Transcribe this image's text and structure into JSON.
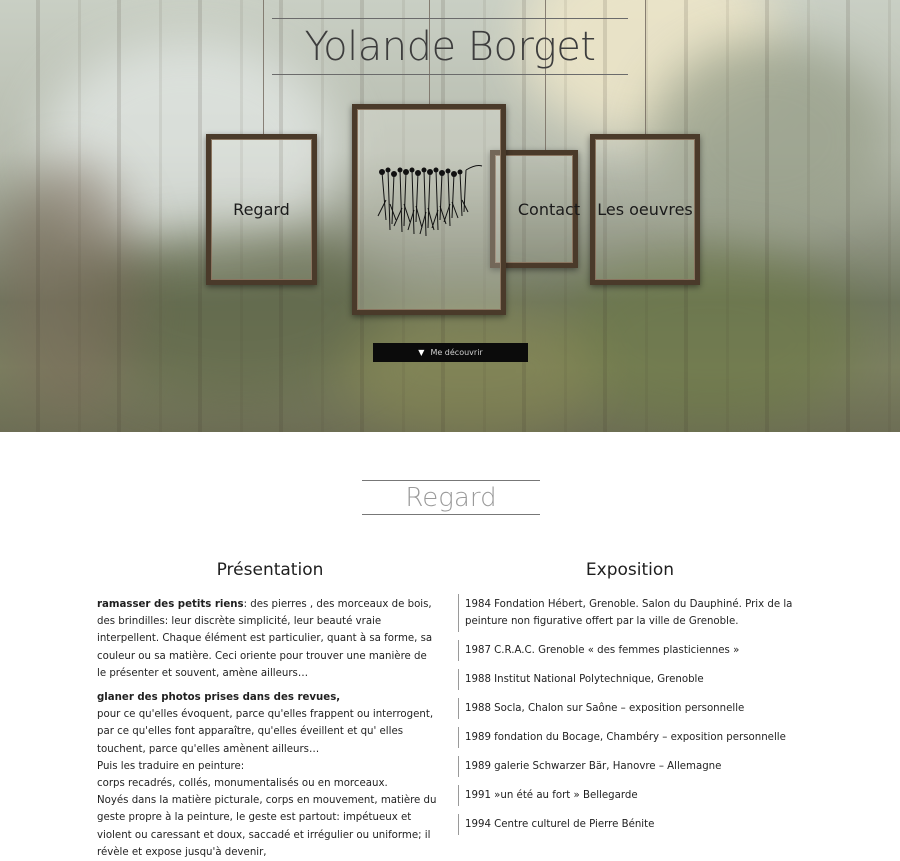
{
  "header": {
    "title": "Yolande Borget",
    "discover_label": "Me découvrir"
  },
  "nav": {
    "regard": "Regard",
    "contact": "Contact",
    "oeuvres": "Les oeuvres"
  },
  "section": {
    "title": "Regard",
    "presentation": {
      "heading": "Présentation",
      "p1_bold": "ramasser des petits riens",
      "p1_text": ": des pierres , des morceaux de bois, des brindilles: leur discrète simplicité, leur beauté vraie interpellent. Chaque élément est particulier, quant à sa forme, sa couleur ou sa matière. Ceci oriente pour trouver une manière de le présenter et souvent, amène ailleurs…",
      "p2_bold": "glaner des photos prises dans des revues,",
      "p2_line1": "pour ce qu'elles évoquent, parce qu'elles frappent ou interrogent, par ce qu'elles font apparaître, qu'elles éveillent et qu' elles touchent, parce qu'elles amènent ailleurs…",
      "p2_line2": "Puis les traduire en peinture:",
      "p2_line3": "corps recadrés, collés, monumentalisés ou en morceaux.",
      "p2_line4": "Noyés dans la matière picturale, corps en mouvement, matière du geste propre à la peinture, le geste est partout: impétueux et violent ou caressant et doux, saccadé et irrégulier ou uniforme; il révèle et expose jusqu'à devenir,"
    },
    "exposition": {
      "heading": "Exposition",
      "items": [
        "1984 Fondation Hébert, Grenoble. Salon du Dauphiné. Prix de la peinture non figurative offert par la ville de Grenoble.",
        "1987 C.R.A.C. Grenoble « des femmes plasticiennes »",
        "1988 Institut National Polytechnique, Grenoble",
        "1988 Socla, Chalon sur Saône – exposition personnelle",
        "1989 fondation du Bocage, Chambéry – exposition personnelle",
        "1989 galerie Schwarzer Bär, Hanovre – Allemagne",
        "1991  »un été au fort » Bellegarde",
        "1994 Centre culturel de Pierre Bénite"
      ]
    }
  }
}
